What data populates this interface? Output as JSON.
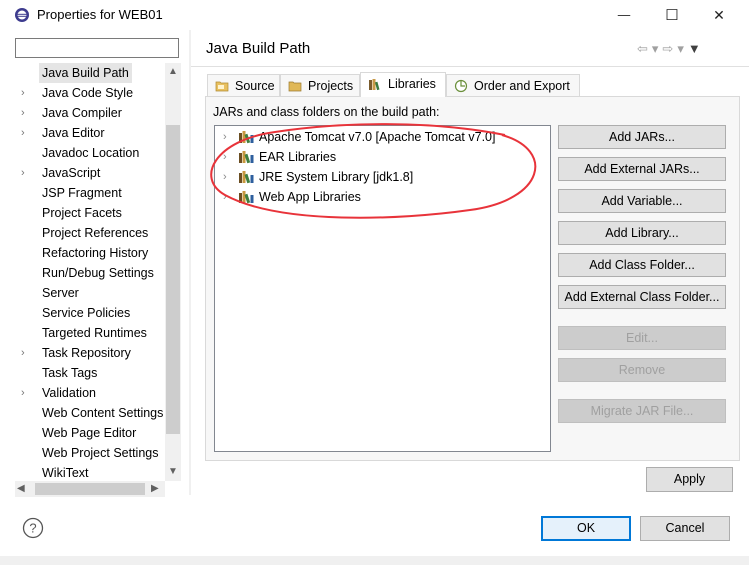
{
  "window": {
    "title": "Properties for WEB01",
    "controls": {
      "minimize": "—",
      "maximize": "☐",
      "close": "✕"
    }
  },
  "sidebar": {
    "filter_value": "",
    "items": [
      {
        "label": "Java Build Path",
        "expandable": false,
        "selected": true
      },
      {
        "label": "Java Code Style",
        "expandable": true
      },
      {
        "label": "Java Compiler",
        "expandable": true
      },
      {
        "label": "Java Editor",
        "expandable": true
      },
      {
        "label": "Javadoc Location",
        "expandable": false
      },
      {
        "label": "JavaScript",
        "expandable": true
      },
      {
        "label": "JSP Fragment",
        "expandable": false
      },
      {
        "label": "Project Facets",
        "expandable": false
      },
      {
        "label": "Project References",
        "expandable": false
      },
      {
        "label": "Refactoring History",
        "expandable": false
      },
      {
        "label": "Run/Debug Settings",
        "expandable": false
      },
      {
        "label": "Server",
        "expandable": false
      },
      {
        "label": "Service Policies",
        "expandable": false
      },
      {
        "label": "Targeted Runtimes",
        "expandable": false
      },
      {
        "label": "Task Repository",
        "expandable": true
      },
      {
        "label": "Task Tags",
        "expandable": false
      },
      {
        "label": "Validation",
        "expandable": true
      },
      {
        "label": "Web Content Settings",
        "expandable": false
      },
      {
        "label": "Web Page Editor",
        "expandable": false
      },
      {
        "label": "Web Project Settings",
        "expandable": false
      },
      {
        "label": "WikiText",
        "expandable": false
      }
    ]
  },
  "page": {
    "title": "Java Build Path",
    "nav_icons": [
      "back-arrow-icon",
      "forward-arrow-icon",
      "menu-down-icon"
    ]
  },
  "tabs": [
    {
      "label": "Source",
      "icon": "source-folder-icon"
    },
    {
      "label": "Projects",
      "icon": "projects-icon"
    },
    {
      "label": "Libraries",
      "icon": "library-icon",
      "active": true
    },
    {
      "label": "Order and Export",
      "icon": "order-export-icon"
    }
  ],
  "libraries": {
    "label": "JARs and class folders on the build path:",
    "items": [
      {
        "label": "Apache Tomcat v7.0 [Apache Tomcat v7.0]"
      },
      {
        "label": "EAR Libraries"
      },
      {
        "label": "JRE System Library [jdk1.8]"
      },
      {
        "label": "Web App Libraries"
      }
    ]
  },
  "actions": [
    {
      "label": "Add JARs...",
      "enabled": true
    },
    {
      "label": "Add External JARs...",
      "enabled": true
    },
    {
      "label": "Add Variable...",
      "enabled": true
    },
    {
      "label": "Add Library...",
      "enabled": true
    },
    {
      "label": "Add Class Folder...",
      "enabled": true
    },
    {
      "label": "Add External Class Folder...",
      "enabled": true
    },
    {
      "label": "Edit...",
      "enabled": false
    },
    {
      "label": "Remove",
      "enabled": false
    },
    {
      "label": "Migrate JAR File...",
      "enabled": false
    }
  ],
  "footer": {
    "apply": "Apply",
    "ok": "OK",
    "cancel": "Cancel"
  },
  "colors": {
    "annotation": "#e8333a",
    "ok_border": "#0078d7"
  }
}
